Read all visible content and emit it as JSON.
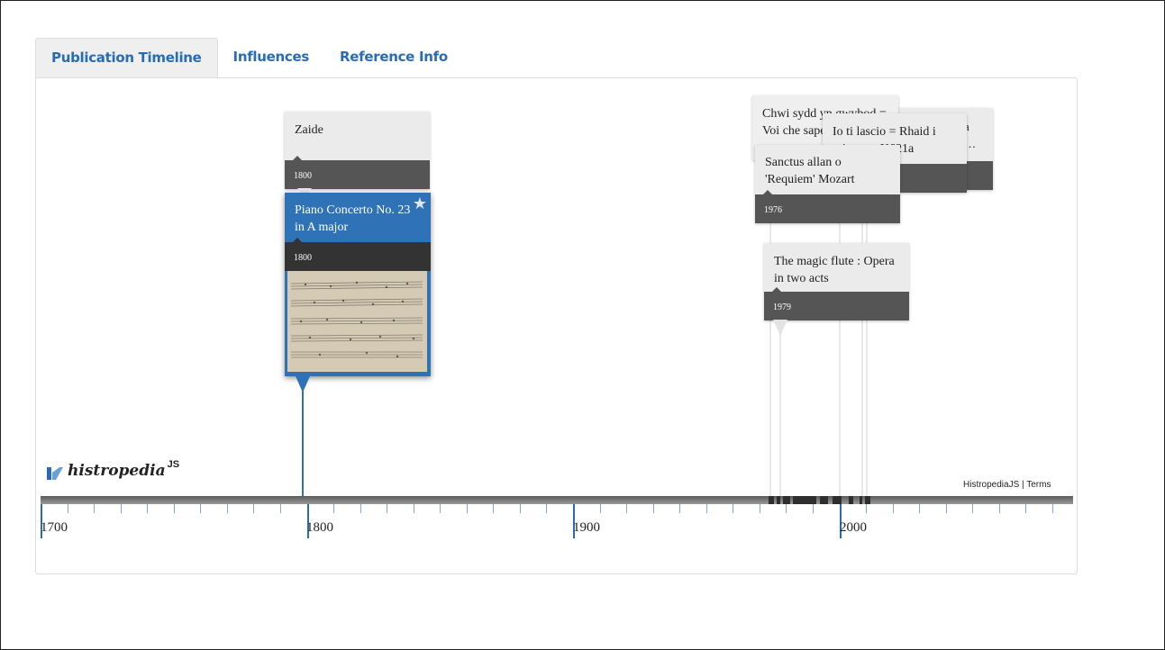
{
  "tabs": [
    {
      "label": "Publication Timeline",
      "active": true
    },
    {
      "label": "Influences",
      "active": false
    },
    {
      "label": "Reference Info",
      "active": false
    }
  ],
  "cards": {
    "zaide": {
      "title": "Zaide",
      "year": "1800"
    },
    "piano": {
      "title": "Piano Concerto No. 23 in A major",
      "year": "1800",
      "starred": true
    },
    "chwi": {
      "title": "Chwi sydd yn gwybod = Voi che sapete",
      "year": ""
    },
    "io_ti": {
      "title": "Io ti lascio = Rhaid i minnau : K621a",
      "year": ""
    },
    "hidden_right": {
      "title_line1": "a",
      "title_line2": "…"
    },
    "sanctus": {
      "title": "Sanctus allan o 'Requiem' Mozart",
      "year": "1976"
    },
    "magic_flute": {
      "title": "The magic flute : Opera in two acts",
      "year": "1979"
    }
  },
  "axis": {
    "labels": [
      "1700",
      "1800",
      "1900",
      "2000"
    ]
  },
  "logo": {
    "text": "histropedia",
    "suffix": "JS"
  },
  "footer": {
    "brand": "HistropediaJS",
    "separator": " | ",
    "terms": "Terms"
  },
  "colors": {
    "accent": "#2f72b6",
    "link": "#2a6cb3",
    "year_bar": "#555555"
  }
}
